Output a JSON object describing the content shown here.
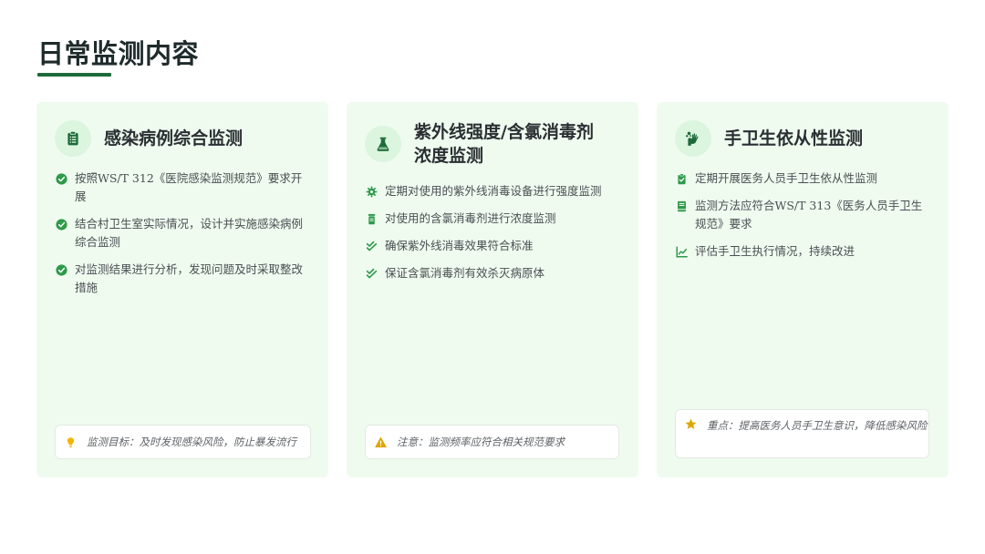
{
  "page": {
    "title": "日常监测内容"
  },
  "colors": {
    "accent": "#1e6b3a",
    "check": "#2e9a4a",
    "card_bg": "#effbef",
    "warn": "#e0a500",
    "bulb": "#f2b600"
  },
  "cards": [
    {
      "icon": "clipboard-icon",
      "title": "感染病例综合监测",
      "items": [
        {
          "icon": "check-circle-icon",
          "text": "按照WS/T 312《医院感染监测规范》要求开展"
        },
        {
          "icon": "check-circle-icon",
          "text": "结合村卫生室实际情况，设计并实施感染病例综合监测"
        },
        {
          "icon": "check-circle-icon",
          "text": "对监测结果进行分析，发现问题及时采取整改措施"
        }
      ],
      "note": {
        "icon": "lightbulb-icon",
        "text": "监测目标：及时发现感染风险，防止暴发流行"
      }
    },
    {
      "icon": "flask-icon",
      "title_line1": "紫外线强度/含氯消毒剂",
      "title_line2": "浓度监测",
      "items": [
        {
          "icon": "gear-icon",
          "text": "定期对使用的紫外线消毒设备进行强度监测"
        },
        {
          "icon": "bottle-icon",
          "text": "对使用的含氯消毒剂进行浓度监测"
        },
        {
          "icon": "double-check-icon",
          "text": "确保紫外线消毒效果符合标准"
        },
        {
          "icon": "double-check-icon",
          "text": "保证含氯消毒剂有效杀灭病原体"
        }
      ],
      "note": {
        "icon": "warning-icon",
        "text": "注意：监测频率应符合相关规范要求"
      }
    },
    {
      "icon": "hands-wash-icon",
      "title": "手卫生依从性监测",
      "items": [
        {
          "icon": "clipboard-check-icon",
          "text": "定期开展医务人员手卫生依从性监测"
        },
        {
          "icon": "book-icon",
          "text": "监测方法应符合WS/T 313《医务人员手卫生规范》要求"
        },
        {
          "icon": "chart-line-icon",
          "text": "评估手卫生执行情况，持续改进"
        }
      ],
      "note": {
        "icon": "star-icon",
        "text": "重点：提高医务人员手卫生意识，降低感染风险"
      }
    }
  ]
}
